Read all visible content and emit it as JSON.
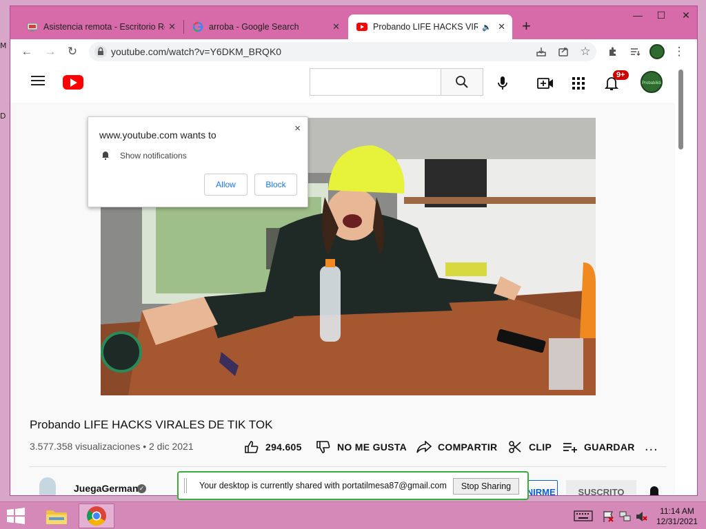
{
  "desktop": {
    "edge_letters": [
      "M",
      "D"
    ]
  },
  "browser": {
    "tabs": [
      {
        "title": "Asistencia remota - Escritorio Re",
        "favicon": "remote-desktop-icon",
        "active": false
      },
      {
        "title": "arroba - Google Search",
        "favicon": "google-icon",
        "active": false
      },
      {
        "title": "Probando LIFE HACKS VIRAL",
        "favicon": "youtube-icon",
        "active": true
      }
    ],
    "new_tab_label": "+",
    "url": "youtube.com/watch?v=Y6DKM_BRQK0",
    "window_controls": {
      "minimize": "—",
      "maximize": "☐",
      "close": "✕"
    }
  },
  "youtube": {
    "notification_badge": "9+",
    "avatar_text": "Probabilidad y Estadistica",
    "video": {
      "title": "Probando LIFE HACKS VIRALES DE TIK TOK",
      "meta": "3.577.358 visualizaciones • 2 dic 2021"
    },
    "actions": {
      "like": "294.605",
      "dislike": "NO ME GUSTA",
      "share": "COMPARTIR",
      "clip": "CLIP",
      "save": "GUARDAR",
      "more": "..."
    },
    "channel": {
      "name": "JuegaGerman",
      "join_label": "UNIRME",
      "subscribe_label": "SUSCRITO"
    }
  },
  "notification_prompt": {
    "site": "www.youtube.com wants to",
    "permission": "Show notifications",
    "allow": "Allow",
    "block": "Block",
    "close": "×"
  },
  "sharing_bar": {
    "message": "Your desktop is currently shared with portatilmesa87@gmail.com",
    "stop_label": "Stop Sharing"
  },
  "taskbar": {
    "time": "11:14 AM",
    "date": "12/31/2021"
  },
  "colors": {
    "titlebar": "#d76aa9",
    "youtube_red": "#ff0000",
    "share_border": "#3cab3c",
    "taskbar": "#d589b8"
  }
}
